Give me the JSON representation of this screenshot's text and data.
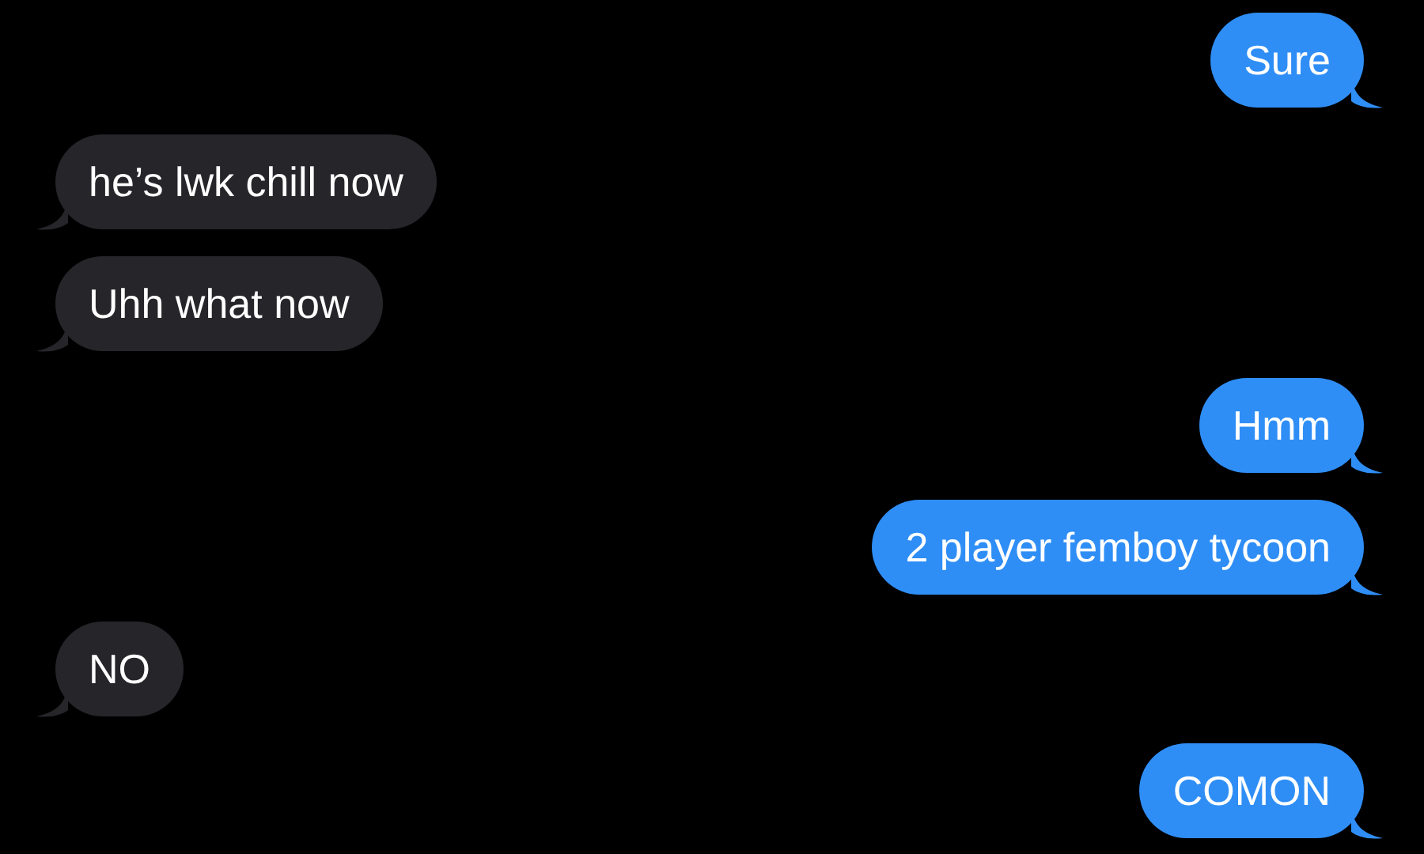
{
  "messages": [
    {
      "kind": "sent",
      "text": "Sure"
    },
    {
      "kind": "received",
      "text": "he’s lwk chill now"
    },
    {
      "kind": "received",
      "text": "Uhh what now"
    },
    {
      "kind": "sent",
      "text": "Hmm"
    },
    {
      "kind": "sent",
      "text": "2 player femboy tycoon"
    },
    {
      "kind": "received",
      "text": "NO"
    },
    {
      "kind": "sent",
      "text": "COMON"
    }
  ]
}
